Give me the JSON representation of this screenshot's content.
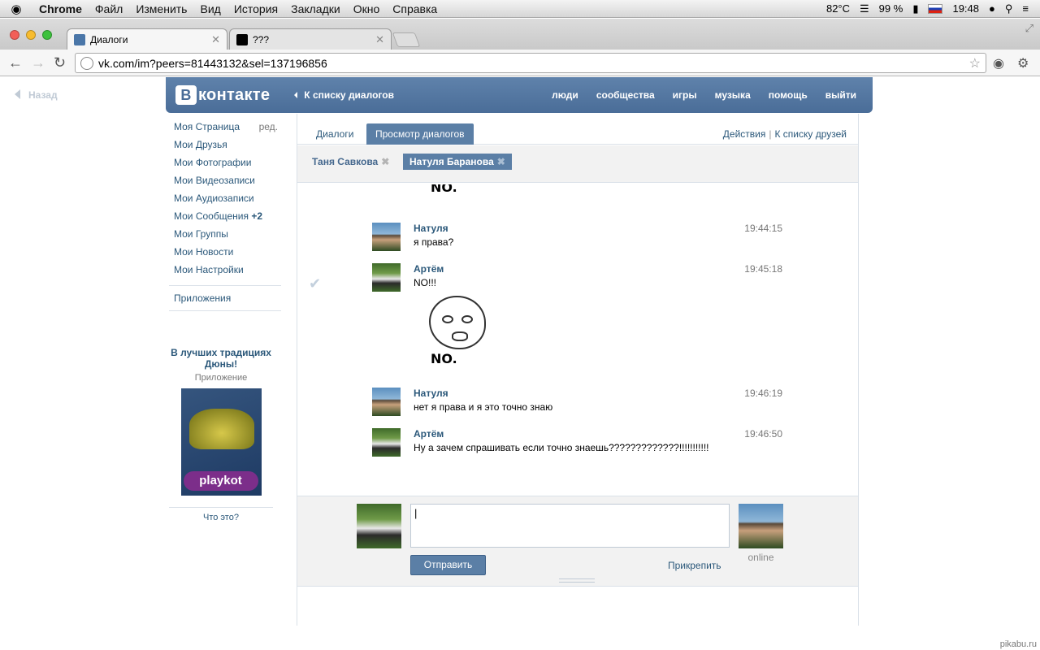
{
  "menubar": {
    "apple": "",
    "items": [
      "Chrome",
      "Файл",
      "Изменить",
      "Вид",
      "История",
      "Закладки",
      "Окно",
      "Справка"
    ],
    "temperature": "82°C",
    "battery": "99 %",
    "time": "19:48"
  },
  "browser": {
    "tabs": [
      {
        "title": "Диалоги",
        "favicon_color": "#4a76a8"
      },
      {
        "title": "???",
        "favicon_color": "#000000"
      }
    ],
    "url": "vk.com/im?peers=81443132&sel=137196856"
  },
  "page": {
    "back_label": "Назад",
    "logo_text": "контакте",
    "logo_letter": "В",
    "to_dialogs": "К списку диалогов",
    "topnav": [
      "люди",
      "сообщества",
      "игры",
      "музыка",
      "помощь",
      "выйти"
    ],
    "sidebar": {
      "my_page": "Моя Страница",
      "edit": "ред.",
      "items": [
        "Мои Друзья",
        "Мои Фотографии",
        "Мои Видеозаписи",
        "Мои Аудиозаписи"
      ],
      "messages": "Мои Сообщения",
      "messages_count": "+2",
      "items2": [
        "Мои Группы",
        "Мои Новости",
        "Мои Настройки"
      ],
      "apps": "Приложения"
    },
    "promo": {
      "title": "В лучших традициях Дюны!",
      "subtitle": "Приложение",
      "brand": "playkot",
      "what": "Что это?"
    },
    "tabs": {
      "dialogs": "Диалоги",
      "view_dialogs": "Просмотр диалогов",
      "actions": "Действия",
      "friends_list": "К списку друзей"
    },
    "peers": [
      "Таня Савкова",
      "Натуля Баранова"
    ],
    "messages": [
      {
        "name": "Натуля",
        "time": "19:44:15",
        "text": "я права?"
      },
      {
        "name": "Артём",
        "time": "19:45:18",
        "text": "NO!!!"
      },
      {
        "name": "Натуля",
        "time": "19:46:19",
        "text": "нет я права и я это точно знаю"
      },
      {
        "name": "Артём",
        "time": "19:46:50",
        "text": "Ну а зачем спрашивать если точно знаешь?????????????!!!!!!!!!!!"
      }
    ],
    "meme_caption": "NO.",
    "compose": {
      "send": "Отправить",
      "attach": "Прикрепить",
      "status": "online"
    },
    "watermark": "pikabu.ru"
  }
}
